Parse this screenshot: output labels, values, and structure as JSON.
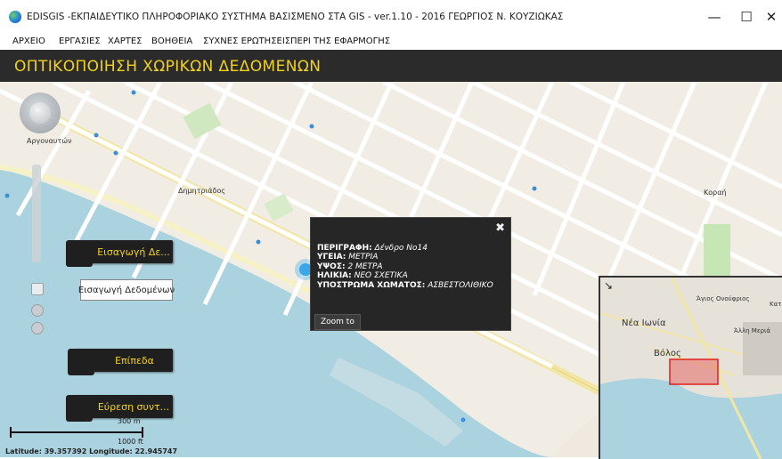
{
  "window": {
    "title": "EDISGIS -ΕΚΠΑΙΔΕΥΤΙΚΟ ΠΛΗΡΟΦΟΡΙΑΚΟ ΣΥΣΤΗΜΑ ΒΑΣΙΣΜΕΝΟ ΣΤΑ GIS - ver.1.10 - 2016 ΓΕΩΡΓΙΟΣ Ν. ΚΟΥΖΙΩΚΑΣ",
    "minimize": "—",
    "maximize": "☐",
    "close": "✕"
  },
  "menu": [
    "ΑΡΧΕΙΟ",
    "ΕΡΓΑΣΙΕΣ",
    "ΧΑΡΤΕΣ",
    "ΒΟΗΘΕΙΑ",
    "ΣΥΧΝΕΣ ΕΡΩΤΗΣΕΙΣ",
    "ΠΕΡΙ ΤΗΣ ΕΦΑΡΜΟΓΗΣ"
  ],
  "header": {
    "title": "ΟΠΤΙΚΟΠΟΙΗΣΗ ΧΩΡΙΚΩΝ ΔΕΔΟΜΕΝΩΝ"
  },
  "buttons": {
    "data_entry_dark": "Εισαγωγή Δε...",
    "data_entry_tooltip": "Εισαγωγή Δεδομένων",
    "layers": "Επίπεδα",
    "find_coords": "Εύρεση συντ..."
  },
  "popup": {
    "close": "✖",
    "rows": [
      {
        "key": "ΠΕΡΙΓΡΑΦΗ:",
        "value": "Δένδρο Νο14"
      },
      {
        "key": "ΥΓΕΙΑ:",
        "value": "ΜΕΤΡΙΑ"
      },
      {
        "key": "ΥΨΟΣ:",
        "value": "2 ΜΕΤΡΑ"
      },
      {
        "key": "ΗΛΙΚΙΑ:",
        "value": "ΝΕΟ ΣΧΕΤΙΚΑ"
      },
      {
        "key": "ΥΠΟΣΤΡΩΜΑ ΧΩΜΑΤΟΣ:",
        "value": "ΑΣΒΕΣΤΟΛΙΘΙΚΟ"
      }
    ],
    "zoom_to": "Zoom to"
  },
  "overview": {
    "labels": [
      "Νέα Ιωνία",
      "Άγιος Ονούφριος",
      "Άλλη Μεριά",
      "Βόλος",
      "Κατ"
    ]
  },
  "scale": {
    "metric": "300 m",
    "imperial": "1000 ft"
  },
  "coords": "Latitude: 39.357392  Longitude: 22.945747",
  "colors": {
    "header_bg": "#2b2b2b",
    "accent": "#f3d21c",
    "sea": "#abd3df",
    "land": "#f1ede4"
  }
}
